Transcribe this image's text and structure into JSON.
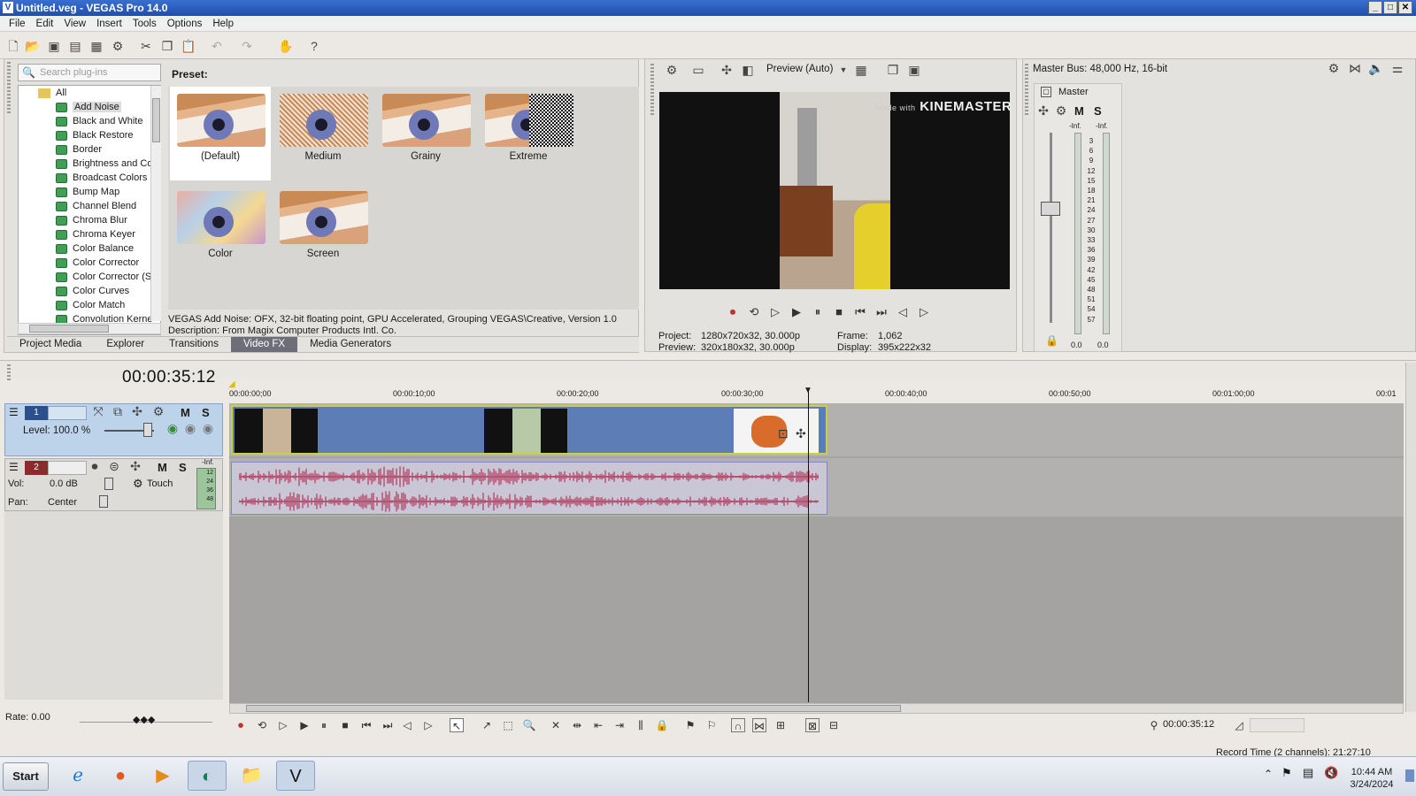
{
  "window": {
    "title": "Untitled.veg - VEGAS Pro 14.0",
    "controls": [
      "_",
      "□",
      "✕"
    ]
  },
  "menu": [
    "File",
    "Edit",
    "View",
    "Insert",
    "Tools",
    "Options",
    "Help"
  ],
  "plugins": {
    "search_placeholder": "Search plug-ins",
    "root": "All",
    "items": [
      "Add Noise",
      "Black and White",
      "Black Restore",
      "Border",
      "Brightness and Co",
      "Broadcast Colors",
      "Bump Map",
      "Channel Blend",
      "Chroma Blur",
      "Chroma Keyer",
      "Color Balance",
      "Color Corrector",
      "Color Corrector (S",
      "Color Curves",
      "Color Match",
      "Convolution Kerne"
    ],
    "preset_label": "Preset:",
    "presets": [
      "(Default)",
      "Medium",
      "Grainy",
      "Extreme",
      "Color",
      "Screen"
    ],
    "description1": "VEGAS Add Noise: OFX, 32-bit floating point, GPU Accelerated, Grouping VEGAS\\Creative, Version 1.0",
    "description2": "Description: From Magix Computer Products Intl. Co.",
    "tabs": [
      "Project Media",
      "Explorer",
      "Transitions",
      "Video FX",
      "Media Generators"
    ]
  },
  "preview": {
    "mode": "Preview (Auto)",
    "watermark_small": "Made with",
    "watermark": "KINEMASTER",
    "project_label": "Project:",
    "project_value": "1280x720x32, 30.000p",
    "preview_label": "Preview:",
    "preview_value": "320x180x32, 30.000p",
    "frame_label": "Frame:",
    "frame_value": "1,062",
    "display_label": "Display:",
    "display_value": "395x222x32"
  },
  "master": {
    "title": "Master Bus: 48,000 Hz, 16-bit",
    "strip": "Master",
    "m": "M",
    "s": "S",
    "inf1": "-Inf.",
    "inf2": "-Inf.",
    "scale": [
      "3",
      "6",
      "9",
      "12",
      "15",
      "18",
      "21",
      "24",
      "27",
      "30",
      "33",
      "36",
      "39",
      "42",
      "45",
      "48",
      "51",
      "54",
      "57"
    ],
    "left_level": "0.0",
    "right_level": "0.0"
  },
  "timeline": {
    "timecode": "00:00:35:12",
    "ruler": [
      "00:00:00;00",
      "00:00:10;00",
      "00:00:20;00",
      "00:00:30;00",
      "00:00:40;00",
      "00:00:50;00",
      "00:01:00;00",
      "00:01"
    ],
    "track1": {
      "number": "1",
      "level": "Level: 100.0 %",
      "m": "M",
      "s": "S"
    },
    "track2": {
      "number": "2",
      "vol_label": "Vol:",
      "vol": "0.0 dB",
      "pan_label": "Pan:",
      "pan": "Center",
      "mode": "Touch",
      "m": "M",
      "s": "S",
      "inf": "-Inf.",
      "meter_scale": [
        "12",
        "24",
        "36",
        "48"
      ]
    },
    "rate": "Rate: 0.00",
    "cursor_time": "00:00:35:12",
    "record_time": "Record Time (2 channels): 21:27:10"
  },
  "taskbar": {
    "start": "Start",
    "time": "10:44 AM",
    "date": "3/24/2024"
  },
  "colors": {
    "titlebar": "#1f4fae",
    "video_clip": "#5d7db6",
    "clip_border": "#c9d23a",
    "audio_wave": "#b2365a",
    "track_header": "#bcd3ea"
  }
}
